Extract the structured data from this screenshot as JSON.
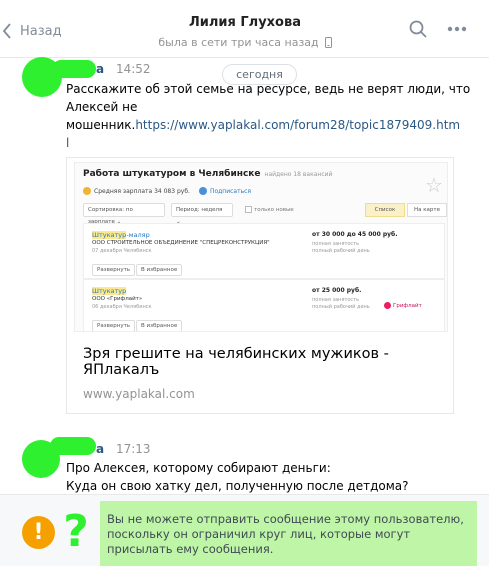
{
  "header": {
    "back_label": "Назад",
    "contact_name": "Лилия Глухова",
    "status": "была в сети три часа назад"
  },
  "date_separator": "сегодня",
  "messages": [
    {
      "sender_visible": "а",
      "time": "14:52",
      "text_line1": "Расскажите об этой семье на ресурсе, ведь не верят люди, что",
      "text_line2": "Алексей не",
      "text_line3_prefix": "мошенник.",
      "link": "https://www.yaplakal.com/forum28/topic1879409.htm",
      "link_tail": "l"
    },
    {
      "sender_visible": "а",
      "time": "17:13",
      "text_line1": "Про Алексея, которому собирают деньги:",
      "text_line2": "Куда он свою хатку дел, полученную после детдома?"
    }
  ],
  "preview": {
    "title": "Зря грешите на челябинских мужиков - ЯПлакалъ",
    "domain": "www.yaplakal.com",
    "screenshot": {
      "heading": "Работа штукатуром в Челябинске",
      "found": "найдено 18 вакансий",
      "avg_salary": "Средняя зарплата 34 083 руб.",
      "subscribe": "Подписаться",
      "sort": "Сортировка: по зарплате",
      "period": "Период: неделя",
      "only_new": "только новые",
      "view_list": "Список",
      "view_map": "На карте",
      "jobs": [
        {
          "title_hl": "Штукатур",
          "title_rest": "-маляр",
          "company": "ООО СТРОИТЕЛЬНОЕ ОБЪЕДИНЕНИЕ \"СПЕЦРЕКОНСТРУКЦИЯ\"",
          "date": "07 декабря  Челябинск",
          "pay": "от 30 000 до 45 000 руб.",
          "employment": "полная занятость",
          "schedule": "полный рабочий день",
          "expand": "Развернуть",
          "favorite": "В избранное"
        },
        {
          "title_hl": "Штукатур",
          "title_rest": "",
          "company": "ООО «Грифлайт»",
          "date": "06 декабря  Челябинск",
          "pay": "от 25 000 руб.",
          "employment": "полная занятость",
          "schedule": "полный рабочий день",
          "logo": "Грифлайт",
          "expand": "Развернуть",
          "favorite": "В избранное"
        }
      ]
    }
  },
  "notice": "Вы не можете отправить сообщение этому пользователю, поскольку он ограничил круг лиц, которые могут присылать ему сообщения.",
  "colors": {
    "accent": "#2a5885",
    "muted": "#939393",
    "censor_green": "#2ef02e",
    "notice_bg": "#bff5a6",
    "warning": "#f6a000"
  },
  "icons": [
    "chevron-left-icon",
    "phone-icon",
    "search-icon",
    "more-icon",
    "warning-icon",
    "question-icon"
  ]
}
